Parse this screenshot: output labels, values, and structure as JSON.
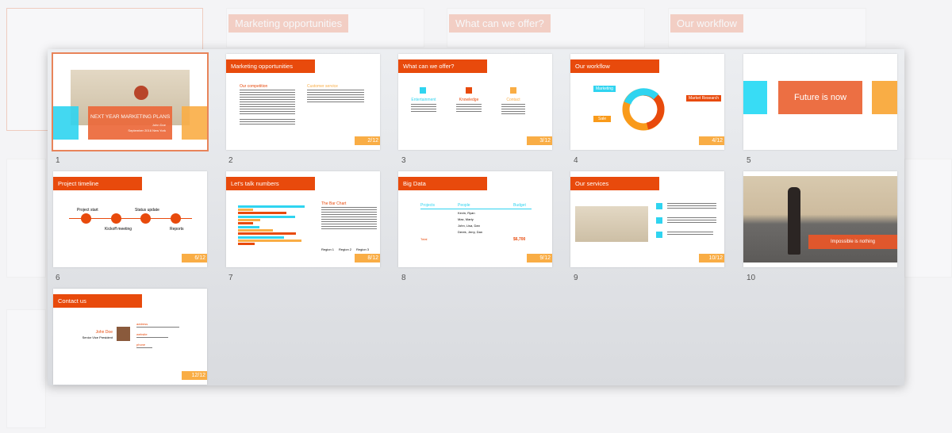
{
  "background": {
    "titles": [
      "Marketing opportunities",
      "What can we offer?",
      "Our workflow"
    ]
  },
  "colors": {
    "accent": "#e84a0c",
    "cyan": "#2fd4f0",
    "amber": "#f9ad45",
    "selection": "#e8845a"
  },
  "slides": [
    {
      "num": "1",
      "title": "NEXT YEAR MARKETING PLANS",
      "sub1": "John Doe",
      "sub2": "September 2016 New York",
      "selected": true
    },
    {
      "num": "2",
      "title": "Marketing opportunities",
      "col1": "Our competition",
      "col2": "Customer service",
      "page": "2/12"
    },
    {
      "num": "3",
      "title": "What can we offer?",
      "items": [
        "Entertainment",
        "Knowledge",
        "Contact"
      ],
      "page": "3/12"
    },
    {
      "num": "4",
      "title": "Our workflow",
      "labels": [
        "Marketing",
        "Market Research",
        "Sale"
      ],
      "page": "4/12"
    },
    {
      "num": "5",
      "title": "Future is now"
    },
    {
      "num": "6",
      "title": "Project timeline",
      "milestones": [
        "Project start",
        "Kickoff meeting",
        "Status update",
        "Reports"
      ],
      "page": "6/12"
    },
    {
      "num": "7",
      "title": "Let's talk numbers",
      "chart_title": "The Bar Chart",
      "legend": [
        "Region 1",
        "Region 2",
        "Region 3"
      ],
      "page": "8/12"
    },
    {
      "num": "8",
      "title": "Big Data",
      "headers": [
        "Projects",
        "People",
        "Budget"
      ],
      "rows": [
        [
          "Kevin, Ryan"
        ],
        [
          "Max, Marty"
        ],
        [
          "John, Lisa, Dan"
        ],
        [
          "Derek, Jerry, Dan"
        ]
      ],
      "total_label": "Total",
      "total": "$6,700",
      "page": "9/12"
    },
    {
      "num": "9",
      "title": "Our services",
      "page": "10/12"
    },
    {
      "num": "10",
      "title": "Impossible is nothing"
    },
    {
      "num": "",
      "title": "Contact us",
      "name": "John Doe",
      "role": "Senior Vice President",
      "address_label": "address",
      "website_label": "website",
      "phone_label": "phone",
      "page": "12/12"
    }
  ]
}
